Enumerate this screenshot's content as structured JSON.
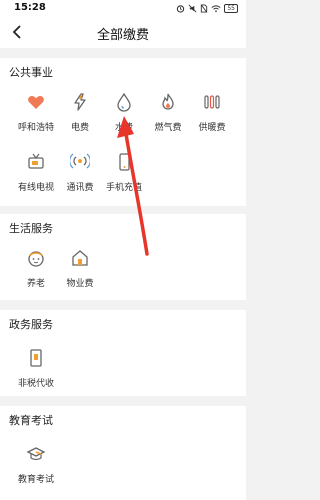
{
  "status_bar": {
    "time": "15:28",
    "battery": "55"
  },
  "header": {
    "title": "全部缴费"
  },
  "sections": [
    {
      "title": "公共事业",
      "items": [
        "呼和浩特",
        "电费",
        "水费",
        "燃气费",
        "供暖费",
        "有线电视",
        "通讯费",
        "手机充值"
      ]
    },
    {
      "title": "生活服务",
      "items": [
        "养老",
        "物业费"
      ]
    },
    {
      "title": "政务服务",
      "items": [
        "非税代收"
      ]
    },
    {
      "title": "教育考试",
      "items": [
        "教育考试"
      ]
    }
  ],
  "colors": {
    "accent": "#f07a2a",
    "annotation_arrow": "#e8352a"
  }
}
